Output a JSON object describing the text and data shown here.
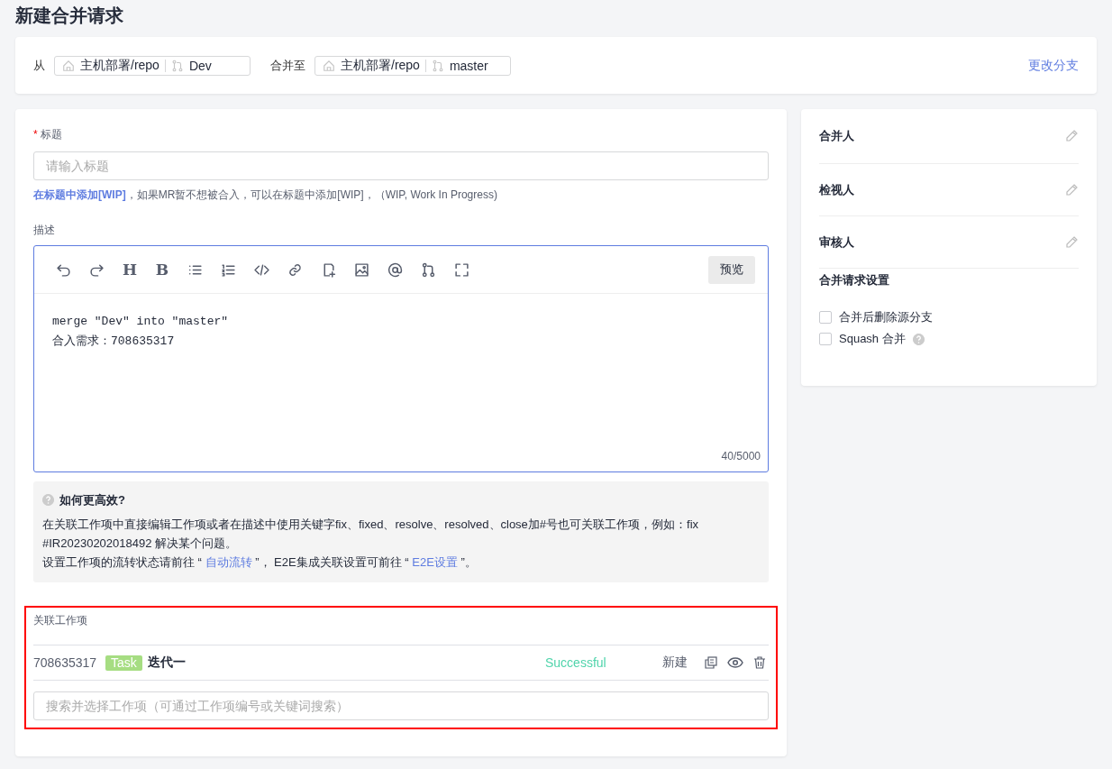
{
  "page_title": "新建合并请求",
  "branches": {
    "from_label": "从",
    "source": {
      "repo": "主机部署/repo",
      "branch": "Dev"
    },
    "to_label": "合并至",
    "target": {
      "repo": "主机部署/repo",
      "branch": "master"
    },
    "change_link": "更改分支"
  },
  "title_field": {
    "label": "标题",
    "required": true,
    "required_marker": "*",
    "placeholder": "请输入标题"
  },
  "wip_hint": {
    "link": "在标题中添加[WIP]",
    "text": "，如果MR暂不想被合入，可以在标题中添加[WIP]，（WIP, Work In Progress)"
  },
  "description": {
    "label": "描述",
    "toolbar": [
      {
        "kind": "undo"
      },
      {
        "kind": "redo"
      },
      {
        "kind": "glyph",
        "glyph": "H"
      },
      {
        "kind": "glyph",
        "glyph": "B"
      },
      {
        "kind": "bullets"
      },
      {
        "kind": "numbers"
      },
      {
        "kind": "code"
      },
      {
        "kind": "link"
      },
      {
        "kind": "addfile"
      },
      {
        "kind": "image"
      },
      {
        "kind": "at"
      },
      {
        "kind": "merge"
      },
      {
        "kind": "fullscreen"
      }
    ],
    "preview_button": "预览",
    "lines": [
      "merge \"Dev\" into \"master\"",
      "合入需求：708635317"
    ],
    "counter": "40/5000"
  },
  "tips": {
    "title": "如何更高效?",
    "paragraph": "在关联工作项中直接编辑工作项或者在描述中使用关键字fix、fixed、resolve、resolved、close加#号也可关联工作项，例如：fix #IR20230202018492 解决某个问题。",
    "line_parts": [
      {
        "kind": "text",
        "text": "设置工作项的流转状态请前往 “ "
      },
      {
        "kind": "link",
        "text": "自动流转"
      },
      {
        "kind": "text",
        "text": " ”， E2E集成关联设置可前往 “ "
      },
      {
        "kind": "link",
        "text": "E2E设置"
      },
      {
        "kind": "text",
        "text": " ”。"
      }
    ]
  },
  "work_items": {
    "label": "关联工作项",
    "items": [
      {
        "id": "708635317",
        "type": "Task",
        "title": "迭代一",
        "status": "Successful",
        "state": "新建"
      }
    ],
    "search_placeholder": "搜索并选择工作项（可通过工作项编号或关键词搜索）"
  },
  "people": [
    {
      "label": "合并人"
    },
    {
      "label": "检视人"
    },
    {
      "label": "审核人"
    }
  ],
  "settings": {
    "title": "合并请求设置",
    "options": [
      {
        "label": "合并后删除源分支",
        "checked": false,
        "help": false
      },
      {
        "label": "Squash 合并",
        "checked": false,
        "help": true
      }
    ]
  }
}
